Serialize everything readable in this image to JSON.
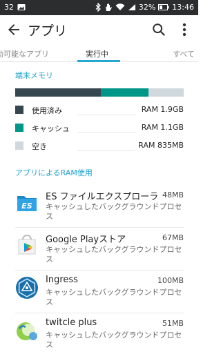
{
  "status_bar": {
    "left_number": "32",
    "battery": "32%",
    "time": "13:46"
  },
  "header": {
    "title": "アプリ"
  },
  "tabs": [
    {
      "label": "動可能なアプリ"
    },
    {
      "label": "実行中"
    },
    {
      "label": "すべて"
    }
  ],
  "memory": {
    "section_title": "端末メモリ",
    "segments": [
      {
        "fraction": 0.51,
        "color": "#37474f"
      },
      {
        "fraction": 0.28,
        "color": "#009688"
      },
      {
        "fraction": 0.21,
        "color": "#cfd8dc"
      }
    ],
    "legend": [
      {
        "name": "使用済み",
        "value": "RAM 1.9GB",
        "color": "#37474f"
      },
      {
        "name": "キャッシュ",
        "value": "RAM 1.1GB",
        "color": "#009688"
      },
      {
        "name": "空き",
        "value": "RAM 835MB",
        "color": "#cfd8dc"
      }
    ]
  },
  "apps_section": {
    "title": "アプリによるRAM使用",
    "apps": [
      {
        "name": "ES ファイルエクスプローラ",
        "size": "48MB",
        "desc": "キャッシュしたバックグラウンドプロセス",
        "icon": "es-file-explorer-icon"
      },
      {
        "name": "Google Playストア",
        "size": "67MB",
        "desc": "キャッシュしたバックグラウンドプロセス",
        "icon": "google-play-store-icon"
      },
      {
        "name": "Ingress",
        "size": "100MB",
        "desc": "キャッシュしたバックグラウンドプロセス",
        "icon": "ingress-icon"
      },
      {
        "name": "twitcle plus",
        "size": "51MB",
        "desc": "キャッシュしたバックグラウンドプロセス",
        "icon": "twitcle-plus-icon"
      }
    ]
  }
}
